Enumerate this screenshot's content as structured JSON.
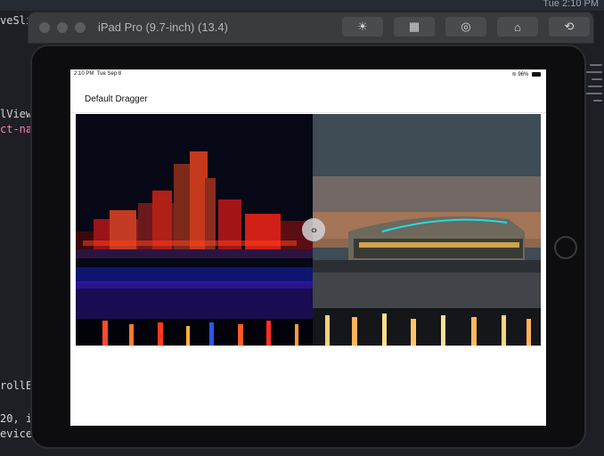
{
  "mac": {
    "menubar_text": "Tue 2:10 PM"
  },
  "simulator": {
    "title": "iPad Pro (9.7-inch) (13.4)",
    "toolbar_buttons": [
      {
        "name": "brightness",
        "glyph": "☀"
      },
      {
        "name": "home",
        "glyph": "▦"
      },
      {
        "name": "screenshot",
        "glyph": "◎"
      },
      {
        "name": "home-screen",
        "glyph": "⌂"
      },
      {
        "name": "rotate",
        "glyph": "⟲"
      }
    ]
  },
  "editor": {
    "lines": [
      {
        "text": "veSli",
        "color": "#d6d6d6"
      },
      {
        "text": "lView",
        "color": "#d6d6d6"
      },
      {
        "text": "ct-na",
        "color": "#ff7ab2"
      },
      {
        "text": "rollEr",
        "color": "#d6d6d6"
      },
      {
        "text": "20, i",
        "color": "#d6d6d6"
      },
      {
        "text": "eviceW",
        "color": "#d6d6d6"
      }
    ]
  },
  "ios": {
    "time": "2:10 PM",
    "date": "Tue Sep 8",
    "battery": "96%",
    "page_title": "Default Dragger"
  },
  "compare": {
    "split_fraction": 0.51,
    "handle_glyph": "‹›"
  }
}
